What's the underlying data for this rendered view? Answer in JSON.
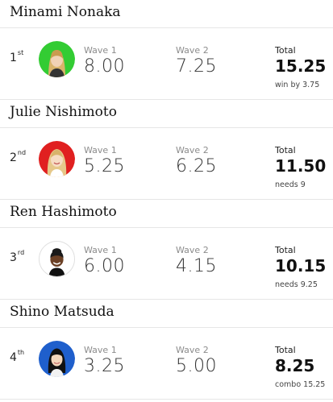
{
  "surfers": [
    {
      "name": "Minami Nonaka",
      "rank_number": "1",
      "rank_suffix": "st",
      "avatar_color": "#33cc33",
      "wave1_label": "Wave 1",
      "wave1_score": "8.00",
      "wave2_label": "Wave 2",
      "wave2_score": "7.25",
      "total_label": "Total",
      "total_score": "15.25",
      "note": "win by 3.75"
    },
    {
      "name": "Julie Nishimoto",
      "rank_number": "2",
      "rank_suffix": "nd",
      "avatar_color": "#e02020",
      "wave1_label": "Wave 1",
      "wave1_score": "5.25",
      "wave2_label": "Wave 2",
      "wave2_score": "6.25",
      "total_label": "Total",
      "total_score": "11.50",
      "note": "needs 9"
    },
    {
      "name": "Ren Hashimoto",
      "rank_number": "3",
      "rank_suffix": "rd",
      "avatar_color": "#ffffff",
      "wave1_label": "Wave 1",
      "wave1_score": "6.00",
      "wave2_label": "Wave 2",
      "wave2_score": "4.15",
      "total_label": "Total",
      "total_score": "10.15",
      "note": "needs 9.25"
    },
    {
      "name": "Shino Matsuda",
      "rank_number": "4",
      "rank_suffix": "th",
      "avatar_color": "#1f5fcc",
      "wave1_label": "Wave 1",
      "wave1_score": "3.25",
      "wave2_label": "Wave 2",
      "wave2_score": "5.00",
      "total_label": "Total",
      "total_score": "8.25",
      "note": "combo 15.25"
    }
  ]
}
